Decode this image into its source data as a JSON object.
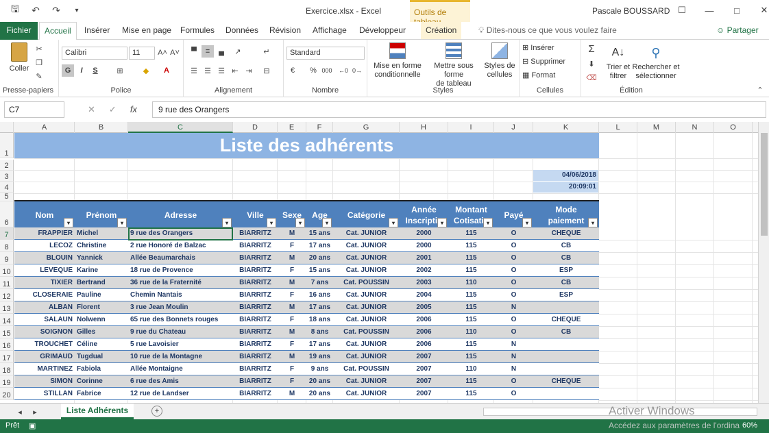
{
  "window": {
    "doc_title": "Exercice.xlsx - Excel",
    "tool_tab": "Outils de tableau",
    "user": "Pascale BOUSSARD"
  },
  "tabs": {
    "file": "Fichier",
    "home": "Accueil",
    "insert": "Insérer",
    "layout": "Mise en page",
    "formulas": "Formules",
    "data": "Données",
    "review": "Révision",
    "view": "Affichage",
    "developer": "Développeur",
    "design": "Création",
    "tell_me": "Dites-nous ce que vous voulez faire",
    "share": "Partager"
  },
  "ribbon": {
    "paste": "Coller",
    "clipboard": "Presse-papiers",
    "font_name": "Calibri",
    "font_size": "11",
    "bold": "G",
    "italic": "I",
    "underline": "S",
    "font": "Police",
    "alignment": "Alignement",
    "number_format": "Standard",
    "number": "Nombre",
    "percent": "%",
    "thousands": "000",
    "cond_format_1": "Mise en forme",
    "cond_format_2": "conditionnelle",
    "table_format_1": "Mettre sous forme",
    "table_format_2": "de tableau",
    "cell_styles_1": "Styles de",
    "cell_styles_2": "cellules",
    "styles": "Styles",
    "insert": "Insérer",
    "delete": "Supprimer",
    "format": "Format",
    "cells": "Cellules",
    "sort_1": "Trier et",
    "sort_2": "filtrer",
    "find_1": "Rechercher et",
    "find_2": "sélectionner",
    "editing": "Édition"
  },
  "formula_bar": {
    "name_box": "C7",
    "formula": "9 rue des Orangers"
  },
  "grid": {
    "columns": [
      "A",
      "B",
      "C",
      "D",
      "E",
      "F",
      "G",
      "H",
      "I",
      "J",
      "K",
      "L",
      "M",
      "N",
      "O"
    ],
    "title": "Liste des adhérents",
    "date": "04/06/2018",
    "time": "20:09:01",
    "headers": [
      {
        "l1": "Nom",
        "l2": ""
      },
      {
        "l1": "Prénom",
        "l2": ""
      },
      {
        "l1": "Adresse",
        "l2": ""
      },
      {
        "l1": "Ville",
        "l2": ""
      },
      {
        "l1": "Sexe",
        "l2": ""
      },
      {
        "l1": "Age",
        "l2": ""
      },
      {
        "l1": "Catégorie",
        "l2": ""
      },
      {
        "l1": "Année",
        "l2": "Inscriptio"
      },
      {
        "l1": "Montant",
        "l2": "Cotisatio"
      },
      {
        "l1": "Payé",
        "l2": ""
      },
      {
        "l1": "Mode",
        "l2": "paiement"
      }
    ],
    "rows": [
      [
        "FRAPPIER",
        "Michel",
        "9 rue des Orangers",
        "BIARRITZ",
        "M",
        "15 ans",
        "Cat. JUNIOR",
        "2000",
        "115",
        "O",
        "CHEQUE"
      ],
      [
        "LECOZ",
        "Christine",
        "2 rue Honoré de Balzac",
        "BIARRITZ",
        "F",
        "17 ans",
        "Cat. JUNIOR",
        "2000",
        "115",
        "O",
        "CB"
      ],
      [
        "BLOUIN",
        "Yannick",
        "Allée Beaumarchais",
        "BIARRITZ",
        "M",
        "20 ans",
        "Cat. JUNIOR",
        "2001",
        "115",
        "O",
        "CB"
      ],
      [
        "LEVEQUE",
        "Karine",
        "18 rue de Provence",
        "BIARRITZ",
        "F",
        "15 ans",
        "Cat. JUNIOR",
        "2002",
        "115",
        "O",
        "ESP"
      ],
      [
        "TIXIER",
        "Bertrand",
        "36 rue de la Fraternité",
        "BIARRITZ",
        "M",
        "7 ans",
        "Cat. POUSSIN",
        "2003",
        "110",
        "O",
        "CB"
      ],
      [
        "CLOSERAIE",
        "Pauline",
        "Chemin Nantais",
        "BIARRITZ",
        "F",
        "16 ans",
        "Cat. JUNIOR",
        "2004",
        "115",
        "O",
        "ESP"
      ],
      [
        "ALBAN",
        "Florent",
        "3 rue Jean Moulin",
        "BIARRITZ",
        "M",
        "17 ans",
        "Cat. JUNIOR",
        "2005",
        "115",
        "N",
        ""
      ],
      [
        "SALAUN",
        "Nolwenn",
        "65 rue des Bonnets rouges",
        "BIARRITZ",
        "F",
        "18 ans",
        "Cat. JUNIOR",
        "2006",
        "115",
        "O",
        "CHEQUE"
      ],
      [
        "SOIGNON",
        "Gilles",
        "9 rue du Chateau",
        "BIARRITZ",
        "M",
        "8 ans",
        "Cat. POUSSIN",
        "2006",
        "110",
        "O",
        "CB"
      ],
      [
        "TROUCHET",
        "Céline",
        "5 rue Lavoisier",
        "BIARRITZ",
        "F",
        "17 ans",
        "Cat. JUNIOR",
        "2006",
        "115",
        "N",
        ""
      ],
      [
        "GRIMAUD",
        "Tugdual",
        "10 rue de la Montagne",
        "BIARRITZ",
        "M",
        "19 ans",
        "Cat. JUNIOR",
        "2007",
        "115",
        "N",
        ""
      ],
      [
        "MARTINEZ",
        "Fabiola",
        "Allée Montaigne",
        "BIARRITZ",
        "F",
        "9 ans",
        "Cat. POUSSIN",
        "2007",
        "110",
        "N",
        ""
      ],
      [
        "SIMON",
        "Corinne",
        "6 rue des Amis",
        "BIARRITZ",
        "F",
        "20 ans",
        "Cat. JUNIOR",
        "2007",
        "115",
        "O",
        "CHEQUE"
      ],
      [
        "STILLAN",
        "Fabrice",
        "12 rue de Landser",
        "BIARRITZ",
        "M",
        "20 ans",
        "Cat. JUNIOR",
        "2007",
        "115",
        "O",
        ""
      ]
    ],
    "row_numbers": [
      "1",
      "2",
      "3",
      "4",
      "5",
      "6",
      "7",
      "8",
      "9",
      "10",
      "11",
      "12",
      "13",
      "14",
      "15",
      "16",
      "17",
      "18",
      "19",
      "20"
    ]
  },
  "sheet": {
    "active_tab": "Liste Adhérents"
  },
  "status": {
    "ready": "Prêt",
    "zoom": "60%",
    "watermark_1": "Activer Windows",
    "watermark_2": "Accédez aux paramètres de l'ordina"
  },
  "colors": {
    "accent": "#217346",
    "header_blue": "#4f81bd",
    "title_blue": "#8eb4e3",
    "band_grey": "#d9d9d9"
  }
}
